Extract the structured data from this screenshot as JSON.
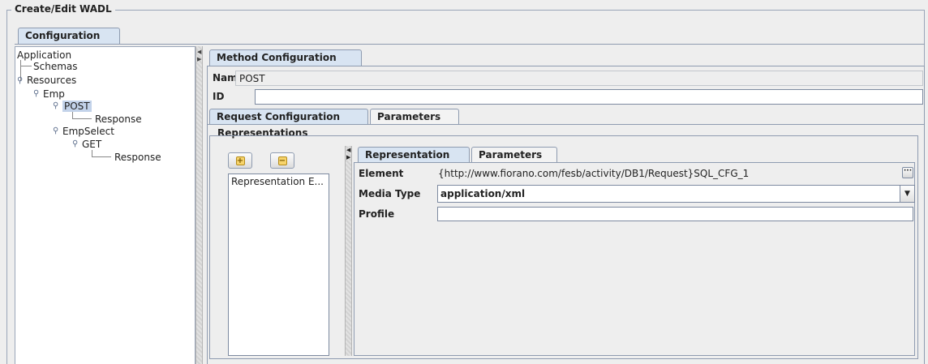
{
  "window": {
    "title": "Create/Edit WADL"
  },
  "main_tab": {
    "label": "Configuration"
  },
  "tree": {
    "root": "Application",
    "schemas": "Schemas",
    "resources": "Resources",
    "emp": "Emp",
    "post": "POST",
    "post_response": "Response",
    "empselect": "EmpSelect",
    "get": "GET",
    "get_response": "Response"
  },
  "method_config": {
    "tab_label": "Method Configuration",
    "name_label": "Name",
    "name_value": "POST",
    "id_label": "ID",
    "id_value": ""
  },
  "request_tabs": {
    "request_configuration": "Request Configuration",
    "parameters": "Parameters"
  },
  "representations": {
    "section_label": "Representations",
    "add_icon": "plus-icon",
    "remove_icon": "minus-icon",
    "list": [
      "Representation E..."
    ]
  },
  "representation_tabs": {
    "representation": "Representation",
    "parameters": "Parameters"
  },
  "representation_form": {
    "element_label": "Element",
    "element_value": "{http://www.fiorano.com/fesb/activity/DB1/Request}SQL_CFG_1",
    "media_type_label": "Media Type",
    "media_type_value": "application/xml",
    "profile_label": "Profile",
    "profile_value": ""
  },
  "colors": {
    "selection": "#c3d3ea",
    "tab_border": "#8e9bb0",
    "background": "#eeeeee"
  }
}
